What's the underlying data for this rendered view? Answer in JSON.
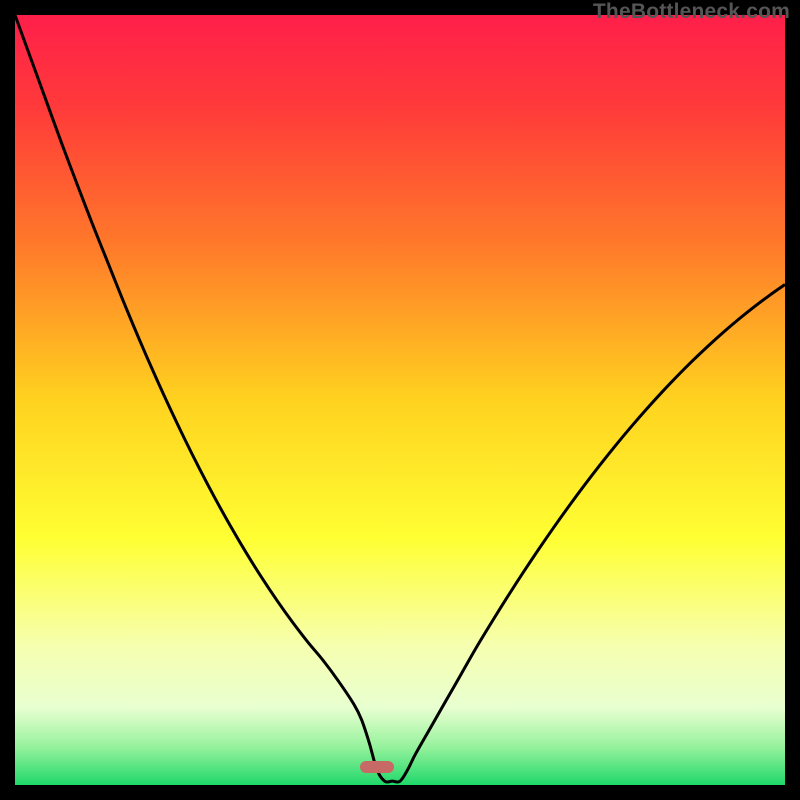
{
  "watermark": "TheBottleneck.com",
  "colors": {
    "frame_bg": "#000000",
    "gradient_stops": [
      {
        "pct": 0,
        "color": "#ff1f4a"
      },
      {
        "pct": 12,
        "color": "#ff3a3a"
      },
      {
        "pct": 30,
        "color": "#ff7a2a"
      },
      {
        "pct": 50,
        "color": "#ffd21f"
      },
      {
        "pct": 68,
        "color": "#ffff33"
      },
      {
        "pct": 82,
        "color": "#f6ffb0"
      },
      {
        "pct": 90,
        "color": "#e8ffd0"
      },
      {
        "pct": 95,
        "color": "#97f29d"
      },
      {
        "pct": 100,
        "color": "#1fd86a"
      }
    ],
    "curve": "#000000",
    "marker": "#c76a66"
  },
  "marker": {
    "x_pct": 47,
    "width_pct": 4.5,
    "y_pct": 97.7
  },
  "chart_data": {
    "type": "line",
    "title": "",
    "xlabel": "",
    "ylabel": "",
    "xlim": [
      0,
      100
    ],
    "ylim": [
      0,
      100
    ],
    "legend": false,
    "grid": false,
    "x": [
      0,
      2,
      4,
      6,
      8,
      10,
      12,
      14,
      16,
      18,
      20,
      22,
      24,
      26,
      28,
      30,
      32,
      34,
      36,
      38,
      40,
      42,
      44,
      45,
      46,
      47,
      48,
      49,
      50,
      51,
      52,
      54,
      56,
      58,
      60,
      62,
      64,
      66,
      68,
      70,
      72,
      74,
      76,
      78,
      80,
      82,
      84,
      86,
      88,
      90,
      92,
      94,
      96,
      98,
      100
    ],
    "values": [
      100,
      94.5,
      89,
      83.5,
      78.2,
      73,
      68,
      63,
      58.2,
      53.6,
      49.2,
      45,
      41,
      37.2,
      33.6,
      30.2,
      27,
      24,
      21.2,
      18.6,
      16.2,
      13.5,
      10.5,
      8.5,
      5.5,
      2.0,
      0.5,
      0.5,
      0.5,
      2.0,
      4.0,
      7.5,
      11,
      14.5,
      18,
      21.3,
      24.5,
      27.6,
      30.6,
      33.5,
      36.3,
      39,
      41.6,
      44.1,
      46.5,
      48.8,
      51,
      53.1,
      55.1,
      57,
      58.8,
      60.5,
      62.1,
      63.6,
      65
    ],
    "annotations": [
      {
        "type": "marker",
        "shape": "rounded-rect",
        "x": 47,
        "y": 0.5,
        "color": "#c76a66"
      }
    ]
  }
}
